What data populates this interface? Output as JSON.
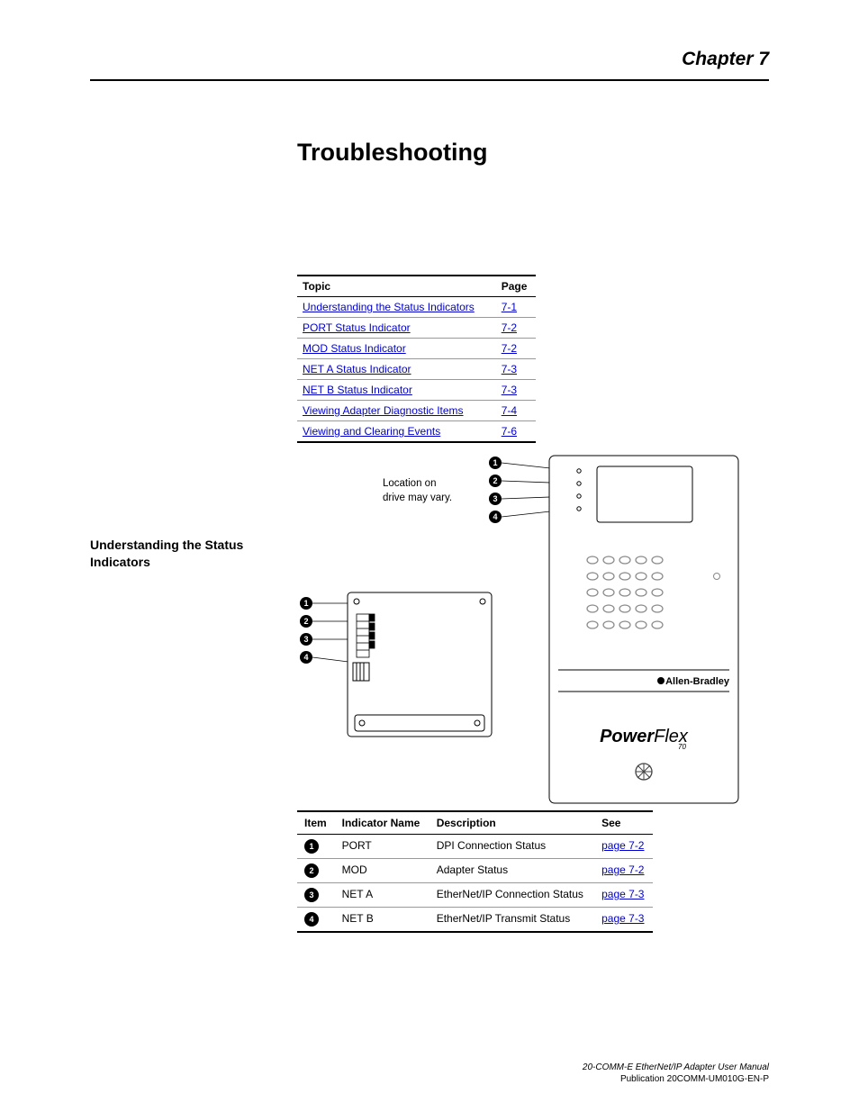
{
  "chapter_label": "Chapter 7",
  "page_title": "Troubleshooting",
  "topic_table": {
    "headers": {
      "topic": "Topic",
      "page": "Page"
    },
    "rows": [
      {
        "topic": "Understanding the Status Indicators",
        "page": "7-1"
      },
      {
        "topic": "PORT Status Indicator",
        "page": "7-2"
      },
      {
        "topic": "MOD Status Indicator",
        "page": "7-2"
      },
      {
        "topic": "NET A Status Indicator",
        "page": "7-3"
      },
      {
        "topic": "NET B Status Indicator",
        "page": "7-3"
      },
      {
        "topic": "Viewing Adapter Diagnostic Items",
        "page": "7-4"
      },
      {
        "topic": "Viewing and Clearing Events",
        "page": "7-6"
      }
    ]
  },
  "section_heading_1": "Understanding the Status",
  "section_heading_2": "Indicators",
  "figure": {
    "note_line1": "Location on",
    "note_line2": "drive may vary.",
    "callouts": [
      "1",
      "2",
      "3",
      "4"
    ],
    "brand_line": "Allen-Bradley",
    "model_line": "PowerFlex",
    "model_sub": "70"
  },
  "indicator_table": {
    "headers": {
      "item": "Item",
      "name": "Indicator Name",
      "desc": "Description",
      "see": "See"
    },
    "rows": [
      {
        "num": "1",
        "name": "PORT",
        "desc": "DPI Connection Status",
        "see": "page 7-2"
      },
      {
        "num": "2",
        "name": "MOD",
        "desc": "Adapter Status",
        "see": "page 7-2"
      },
      {
        "num": "3",
        "name": "NET A",
        "desc": "EtherNet/IP Connection Status",
        "see": "page 7-3"
      },
      {
        "num": "4",
        "name": "NET B",
        "desc": "EtherNet/IP Transmit Status",
        "see": "page 7-3"
      }
    ]
  },
  "footer": {
    "title": "20-COMM-E EtherNet/IP Adapter User Manual",
    "pub": "Publication 20COMM-UM010G-EN-P"
  }
}
